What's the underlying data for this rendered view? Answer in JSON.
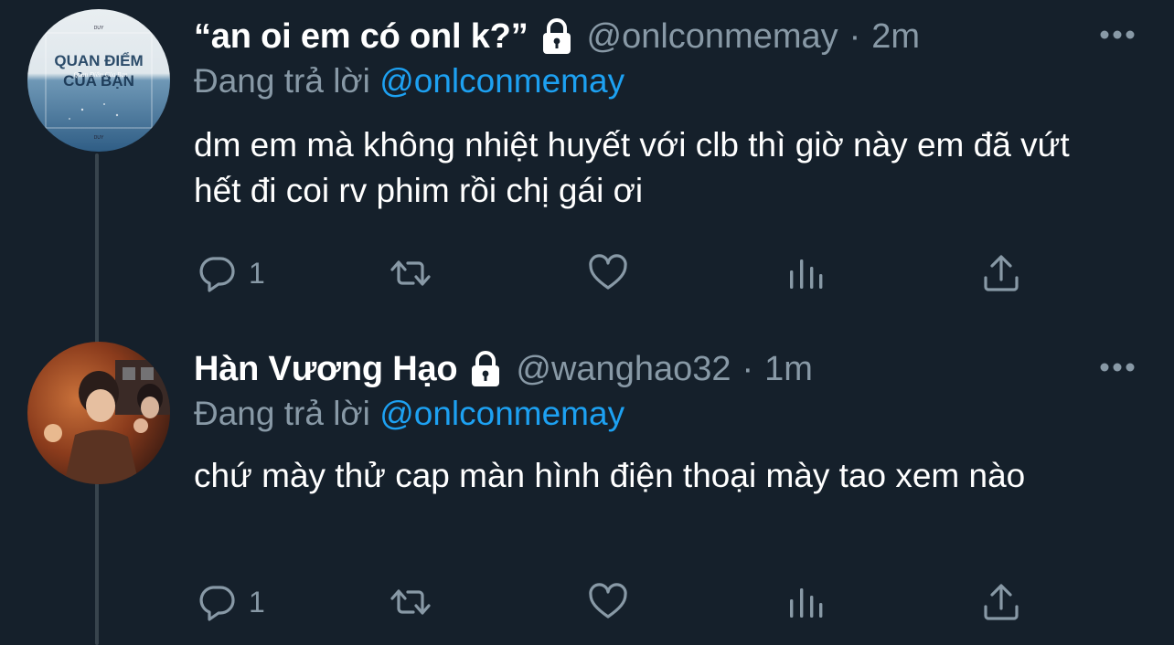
{
  "tweets": [
    {
      "display_name": "“an oi em có onl k?”",
      "handle": "@onlconmemay",
      "separator": "·",
      "time": "2m",
      "replying_prefix": "Đang trả lời",
      "replying_to": "@onlconmemay",
      "text": "dm em mà không nhiệt huyết với clb thì giờ này em đã vứt hết đi coi rv phim rồi chị gái ơi",
      "reply_count": "1",
      "avatar": {
        "title_text": "QUAN ĐIỂM CỦA BẠN",
        "script_text": "Quan Điểm Của Bạn",
        "top_text": "DUY",
        "bottom_text": "DUY"
      }
    },
    {
      "display_name": "Hàn Vương Hạo",
      "handle": "@wanghao32",
      "separator": "·",
      "time": "1m",
      "replying_prefix": "Đang trả lời",
      "replying_to": "@onlconmemay",
      "text": "chứ mày thử cap màn hình điện thoại mày tao xem nào",
      "reply_count": "1"
    }
  ],
  "icons": {
    "lock": "lock-icon",
    "more": "more-icon",
    "reply": "reply-icon",
    "retweet": "retweet-icon",
    "like": "heart-icon",
    "stats": "analytics-icon",
    "share": "share-icon"
  },
  "colors": {
    "background": "#15202b",
    "text": "#ffffff",
    "secondary": "#8899a6",
    "link": "#1da1f2",
    "thread_line": "#38444d"
  }
}
